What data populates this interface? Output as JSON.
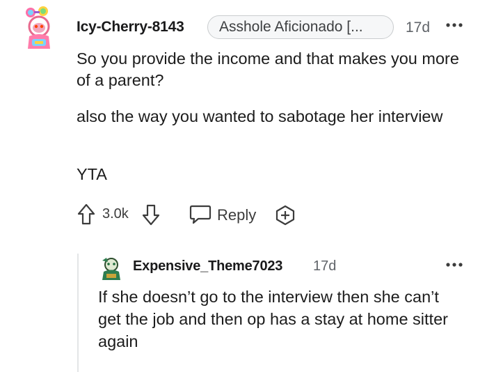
{
  "comment": {
    "username": "Icy-Cherry-8143",
    "flair": "Asshole Aficionado [...",
    "age": "17d",
    "paragraphs": [
      "So you provide the income and that makes you more of a parent?",
      "also the way you wanted to sabotage her interview",
      "YTA"
    ],
    "votes": "3.0k",
    "reply_label": "Reply"
  },
  "reply": {
    "username": "Expensive_Theme7023",
    "age": "17d",
    "text": "If she doesn’t go to the interview then she can’t get the job and then op has a stay at home sitter again"
  },
  "icons": {
    "more": "more-dots-icon",
    "upvote": "upvote-arrow-icon",
    "downvote": "downvote-arrow-icon",
    "reply": "speech-bubble-icon",
    "award": "award-plus-icon"
  },
  "colors": {
    "text": "#1a1a1b",
    "muted": "#5f6368",
    "flair_border": "#c9ccce",
    "thread_line": "#e3e5e7"
  }
}
